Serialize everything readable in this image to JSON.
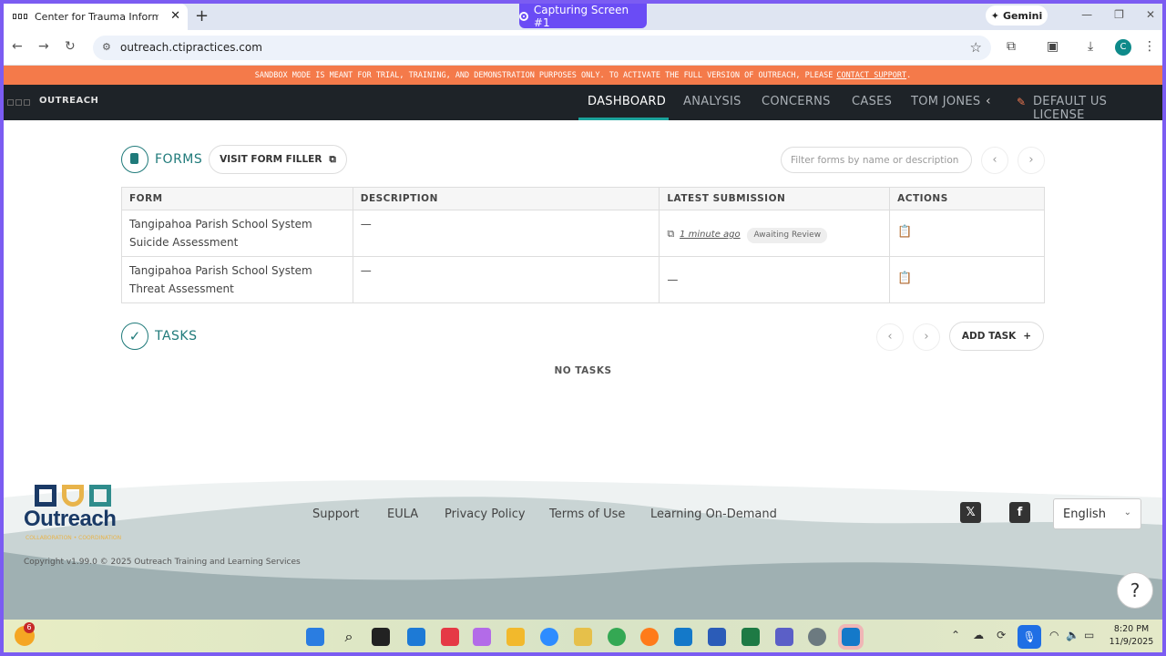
{
  "browser": {
    "tab_title": "Center for Trauma Informed Pra",
    "capture_label": "Capturing Screen #1",
    "gemini_label": "Gemini",
    "url": "outreach.ctipractices.com",
    "profile_initial": "C"
  },
  "banner": {
    "text": "SANDBOX MODE IS MEANT FOR TRIAL, TRAINING, AND DEMONSTRATION PURPOSES ONLY. TO ACTIVATE THE FULL VERSION OF OUTREACH, PLEASE",
    "link": "CONTACT SUPPORT",
    "end": "."
  },
  "app": {
    "name": "OUTREACH",
    "nav": [
      "DASHBOARD",
      "ANALYSIS",
      "CONCERNS",
      "CASES",
      "TOM JONES"
    ],
    "license": "DEFAULT US LICENSE"
  },
  "forms": {
    "title": "FORMS",
    "visit_button": "VISIT FORM FILLER",
    "filter_placeholder": "Filter forms by name or description",
    "columns": [
      "FORM",
      "DESCRIPTION",
      "LATEST SUBMISSION",
      "ACTIONS"
    ],
    "rows": [
      {
        "form_line1": "Tangipahoa Parish School System",
        "form_line2": "Suicide Assessment",
        "description": "—",
        "latest": "1 minute ago",
        "status": "Awaiting Review"
      },
      {
        "form_line1": "Tangipahoa Parish School System",
        "form_line2": "Threat Assessment",
        "description": "—",
        "latest": "—",
        "status": ""
      }
    ]
  },
  "tasks": {
    "title": "TASKS",
    "add_button": "ADD TASK",
    "empty": "NO TASKS"
  },
  "footer": {
    "brand": "Outreach",
    "tagline": "COLLABORATION • COORDINATION",
    "links": [
      "Support",
      "EULA",
      "Privacy Policy",
      "Terms of Use",
      "Learning On-Demand"
    ],
    "copyright": "Copyright v1.99.0 © 2025 Outreach Training and Learning Services",
    "language": "English",
    "help": "?"
  },
  "taskbar": {
    "weather_badge": "6",
    "time": "8:20 PM",
    "date": "11/9/2025"
  },
  "colors": {
    "accent": "#1f7a7a",
    "banner": "#f47a4a",
    "nav_bg": "#1e2328",
    "capture": "#6a4cf5"
  }
}
